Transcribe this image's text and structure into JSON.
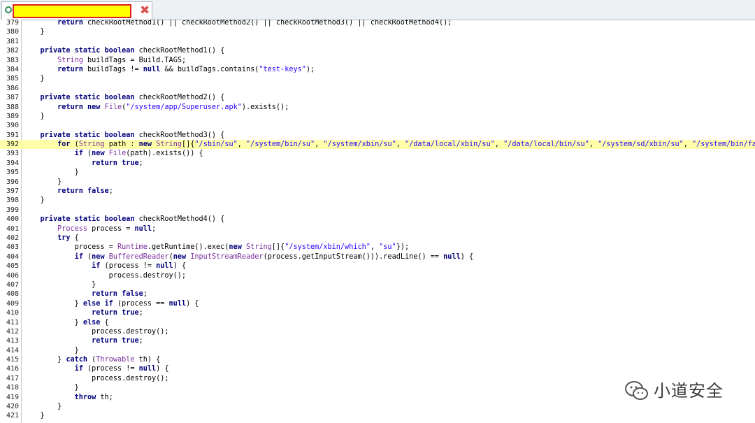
{
  "tab": {
    "label": "",
    "close_glyph": "✖"
  },
  "editor": {
    "highlight_line": 392,
    "lines": [
      {
        "n": "379",
        "html": "        <span class=\"k\">return</span> checkRootMethod1() || checkRootMethod2() || checkRootMethod3() || checkRootMethod4();"
      },
      {
        "n": "380",
        "html": "    }"
      },
      {
        "n": "381",
        "html": ""
      },
      {
        "n": "382",
        "html": "    <span class=\"k\">private static boolean</span> checkRootMethod1() {"
      },
      {
        "n": "383",
        "html": "        <span class=\"t\">String</span> buildTags = Build.TAGS;"
      },
      {
        "n": "384",
        "html": "        <span class=\"k\">return</span> buildTags != <span class=\"k\">null</span> &amp;&amp; buildTags.contains(<span class=\"s\">\"test-keys\"</span>);"
      },
      {
        "n": "385",
        "html": "    }"
      },
      {
        "n": "386",
        "html": ""
      },
      {
        "n": "387",
        "html": "    <span class=\"k\">private static boolean</span> checkRootMethod2() {"
      },
      {
        "n": "388",
        "html": "        <span class=\"k\">return new</span> <span class=\"t\">File</span>(<span class=\"s\">\"/system/app/Superuser.apk\"</span>).exists();"
      },
      {
        "n": "389",
        "html": "    }"
      },
      {
        "n": "390",
        "html": ""
      },
      {
        "n": "391",
        "html": "    <span class=\"k\">private static boolean</span> checkRootMethod3() {"
      },
      {
        "n": "392",
        "html": "        <span class=\"k\">for</span> (<span class=\"t\">String</span> path : <span class=\"k\">new</span> <span class=\"t\">String</span>[]{<span class=\"s\">\"/sbin/su\"</span>, <span class=\"s\">\"/system/bin/su\"</span>, <span class=\"s\">\"/system/xbin/su\"</span>, <span class=\"s\">\"/data/local/xbin/su\"</span>, <span class=\"s\">\"/data/local/bin/su\"</span>, <span class=\"s\">\"/system/sd/xbin/su\"</span>, <span class=\"s\">\"/system/bin/failsafe/su\"</span>"
      },
      {
        "n": "393",
        "html": "            <span class=\"k\">if</span> (<span class=\"k\">new</span> <span class=\"t\">File</span>(path).exists()) {"
      },
      {
        "n": "394",
        "html": "                <span class=\"k\">return true</span>;"
      },
      {
        "n": "395",
        "html": "            }"
      },
      {
        "n": "396",
        "html": "        }"
      },
      {
        "n": "397",
        "html": "        <span class=\"k\">return false</span>;"
      },
      {
        "n": "398",
        "html": "    }"
      },
      {
        "n": "399",
        "html": ""
      },
      {
        "n": "400",
        "html": "    <span class=\"k\">private static boolean</span> checkRootMethod4() {"
      },
      {
        "n": "401",
        "html": "        <span class=\"t\">Process</span> process = <span class=\"k\">null</span>;"
      },
      {
        "n": "402",
        "html": "        <span class=\"k\">try</span> {"
      },
      {
        "n": "403",
        "html": "            process = <span class=\"t\">Runtime</span>.getRuntime().exec(<span class=\"k\">new</span> <span class=\"t\">String</span>[]{<span class=\"s\">\"/system/xbin/which\"</span>, <span class=\"s\">\"su\"</span>});"
      },
      {
        "n": "404",
        "html": "            <span class=\"k\">if</span> (<span class=\"k\">new</span> <span class=\"t\">BufferedReader</span>(<span class=\"k\">new</span> <span class=\"t\">InputStreamReader</span>(process.getInputStream())).readLine() == <span class=\"k\">null</span>) {"
      },
      {
        "n": "405",
        "html": "                <span class=\"k\">if</span> (process != <span class=\"k\">null</span>) {"
      },
      {
        "n": "406",
        "html": "                    process.destroy();"
      },
      {
        "n": "407",
        "html": "                }"
      },
      {
        "n": "408",
        "html": "                <span class=\"k\">return false</span>;"
      },
      {
        "n": "409",
        "html": "            } <span class=\"k\">else if</span> (process == <span class=\"k\">null</span>) {"
      },
      {
        "n": "410",
        "html": "                <span class=\"k\">return true</span>;"
      },
      {
        "n": "411",
        "html": "            } <span class=\"k\">else</span> {"
      },
      {
        "n": "412",
        "html": "                process.destroy();"
      },
      {
        "n": "413",
        "html": "                <span class=\"k\">return true</span>;"
      },
      {
        "n": "414",
        "html": "            }"
      },
      {
        "n": "415",
        "html": "        } <span class=\"k\">catch</span> (<span class=\"t\">Throwable</span> th) {"
      },
      {
        "n": "416",
        "html": "            <span class=\"k\">if</span> (process != <span class=\"k\">null</span>) {"
      },
      {
        "n": "417",
        "html": "                process.destroy();"
      },
      {
        "n": "418",
        "html": "            }"
      },
      {
        "n": "419",
        "html": "            <span class=\"k\">throw</span> th;"
      },
      {
        "n": "420",
        "html": "        }"
      },
      {
        "n": "421",
        "html": "    }"
      }
    ]
  },
  "watermark": {
    "text": "小道安全",
    "icon": "wechat-icon"
  },
  "colors": {
    "keyword": "#00007a",
    "type": "#7a2d9e",
    "string": "#2a00ff",
    "highlight": "#ffffaa",
    "redaction": "#ffff00"
  }
}
